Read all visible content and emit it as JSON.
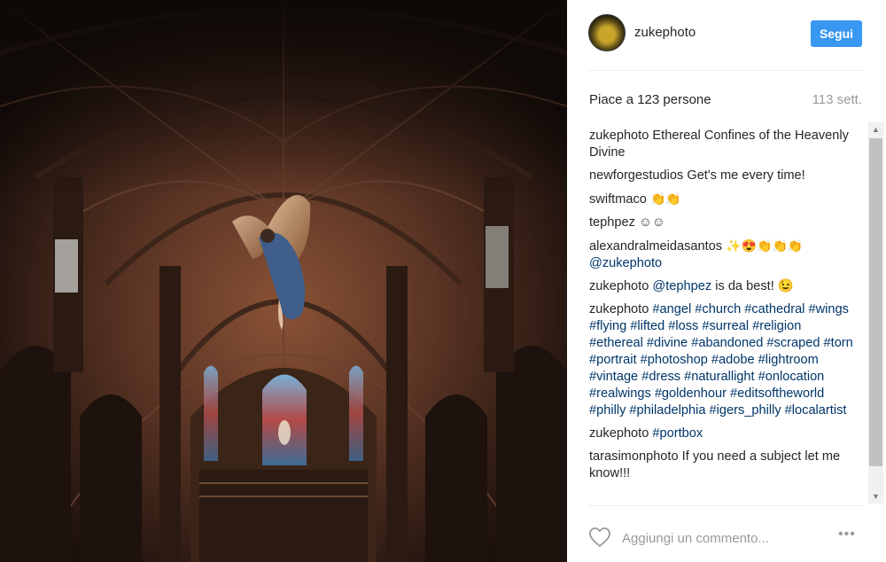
{
  "post": {
    "username": "zukephoto",
    "follow_label": "Segui",
    "likes": "Piace a 123 persone",
    "time_ago": "113 sett.",
    "comment_placeholder": "Aggiungi un commento...",
    "more_label": "•••"
  },
  "comments": [
    {
      "user": "zukephoto",
      "text": "Ethereal Confines of the Heavenly Divine"
    },
    {
      "user": "newforgestudios",
      "text": "Get's me every time!"
    },
    {
      "user": "swiftmaco",
      "text": "👏👏"
    },
    {
      "user": "tephpez",
      "text": "☺☺"
    },
    {
      "user": "alexandralmeidasantos",
      "text": "✨😍👏👏👏",
      "mention": "@zukephoto"
    },
    {
      "user": "zukephoto",
      "mention": "@tephpez",
      "text": " is da best! 😉"
    },
    {
      "user": "zukephoto",
      "hashtags": "#angel #church #cathedral #wings #flying #lifted #loss #surreal #religion #ethereal #divine #abandoned #scraped #torn #portrait #photoshop #adobe #lightroom #vintage #dress #naturallight #onlocation #realwings #goldenhour #editsoftheworld #philly #philadelphia #igers_philly #localartist"
    },
    {
      "user": "zukephoto",
      "hashtags": "#portbox"
    },
    {
      "user": "tarasimonphoto",
      "text": "If you need a subject let me know!!!"
    }
  ],
  "icons": {
    "heart": "heart-outline-icon",
    "scroll_up": "▲",
    "scroll_down": "▼"
  },
  "colors": {
    "follow_button": "#3897f0",
    "hashtag": "#003569",
    "muted": "#999999"
  }
}
